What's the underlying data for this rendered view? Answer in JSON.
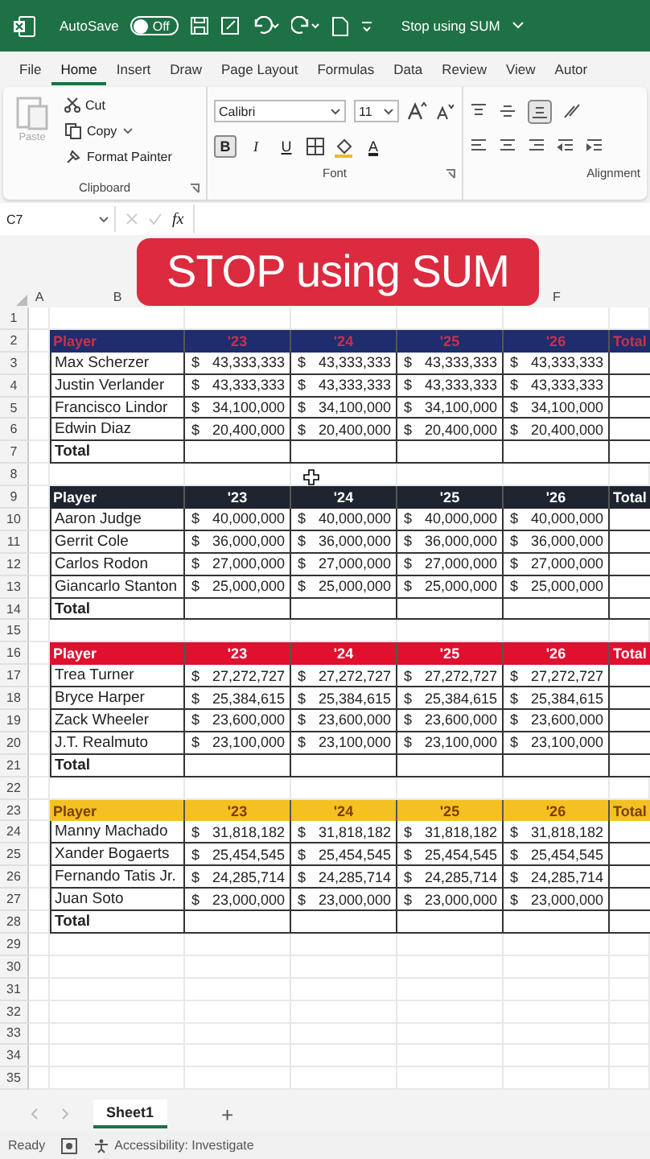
{
  "title_bar": {
    "autosave_label": "AutoSave",
    "autosave_toggle": {
      "label": "Off",
      "on": false
    },
    "file_name": "Stop using SUM"
  },
  "menu_tabs": [
    {
      "label": "File",
      "selected": false
    },
    {
      "label": "Home",
      "selected": true
    },
    {
      "label": "Insert",
      "selected": false
    },
    {
      "label": "Draw",
      "selected": false
    },
    {
      "label": "Page Layout",
      "selected": false
    },
    {
      "label": "Formulas",
      "selected": false
    },
    {
      "label": "Data",
      "selected": false
    },
    {
      "label": "Review",
      "selected": false
    },
    {
      "label": "View",
      "selected": false
    },
    {
      "label": "Autor",
      "selected": false
    }
  ],
  "ribbon": {
    "clipboard": {
      "paste_label": "Paste",
      "cut": "Cut",
      "copy": "Copy",
      "format_painter": "Format Painter",
      "group_label": "Clipboard"
    },
    "font": {
      "font_name": "Calibri",
      "font_size": "11",
      "bold_label": "B",
      "italic_label": "I",
      "underline_label": "U",
      "color_label": "A",
      "bold": true,
      "group_label": "Font"
    },
    "alignment": {
      "group_label": "Alignment"
    }
  },
  "formula_bar": {
    "name_box": "C7",
    "fx_label": "fx"
  },
  "banner": {
    "text": "STOP using SUM"
  },
  "column_headers": [
    {
      "label": "A"
    },
    {
      "label": "B"
    },
    {
      "label": "F"
    }
  ],
  "row_numbers": [
    "1",
    "2",
    "3",
    "4",
    "5",
    "6",
    "7",
    "8",
    "9",
    "10",
    "11",
    "12",
    "13",
    "14",
    "15",
    "16",
    "17",
    "18",
    "19",
    "20",
    "21",
    "22",
    "23",
    "24",
    "25",
    "26",
    "27",
    "28",
    "29",
    "30",
    "31",
    "32",
    "33",
    "34",
    "35"
  ],
  "tables": [
    {
      "color": "#1f2c6e",
      "heading_text": {
        "color": "#c8324c"
      },
      "headers": [
        "Player",
        "'23",
        "'24",
        "'25",
        "'26",
        "Total"
      ],
      "total_label": "Total",
      "rows": [
        {
          "name": "Max Scherzer",
          "values": [
            [
              "$",
              "43,333,333"
            ],
            [
              "$",
              "43,333,333"
            ],
            [
              "$",
              "43,333,333"
            ],
            [
              "$",
              "43,333,333"
            ]
          ]
        },
        {
          "name": "Justin Verlander",
          "values": [
            [
              "$",
              "43,333,333"
            ],
            [
              "$",
              "43,333,333"
            ],
            [
              "$",
              "43,333,333"
            ],
            [
              "$",
              "43,333,333"
            ]
          ]
        },
        {
          "name": "Francisco Lindor",
          "values": [
            [
              "$",
              "34,100,000"
            ],
            [
              "$",
              "34,100,000"
            ],
            [
              "$",
              "34,100,000"
            ],
            [
              "$",
              "34,100,000"
            ]
          ]
        },
        {
          "name": "Edwin Diaz",
          "values": [
            [
              "$",
              "20,400,000"
            ],
            [
              "$",
              "20,400,000"
            ],
            [
              "$",
              "20,400,000"
            ],
            [
              "$",
              "20,400,000"
            ]
          ]
        }
      ]
    },
    {
      "color": "#1e2530",
      "heading_text": {
        "color": "#ffffff"
      },
      "headers": [
        "Player",
        "'23",
        "'24",
        "'25",
        "'26",
        "Total"
      ],
      "total_label": "Total",
      "rows": [
        {
          "name": "Aaron Judge",
          "values": [
            [
              "$",
              "40,000,000"
            ],
            [
              "$",
              "40,000,000"
            ],
            [
              "$",
              "40,000,000"
            ],
            [
              "$",
              "40,000,000"
            ]
          ]
        },
        {
          "name": "Gerrit Cole",
          "values": [
            [
              "$",
              "36,000,000"
            ],
            [
              "$",
              "36,000,000"
            ],
            [
              "$",
              "36,000,000"
            ],
            [
              "$",
              "36,000,000"
            ]
          ]
        },
        {
          "name": "Carlos Rodon",
          "values": [
            [
              "$",
              "27,000,000"
            ],
            [
              "$",
              "27,000,000"
            ],
            [
              "$",
              "27,000,000"
            ],
            [
              "$",
              "27,000,000"
            ]
          ]
        },
        {
          "name": "Giancarlo Stanton",
          "values": [
            [
              "$",
              "25,000,000"
            ],
            [
              "$",
              "25,000,000"
            ],
            [
              "$",
              "25,000,000"
            ],
            [
              "$",
              "25,000,000"
            ]
          ]
        }
      ]
    },
    {
      "color": "#e0102e",
      "heading_text": {
        "color": "#ffffff"
      },
      "headers": [
        "Player",
        "'23",
        "'24",
        "'25",
        "'26",
        "Total"
      ],
      "total_label": "Total",
      "rows": [
        {
          "name": "Trea Turner",
          "values": [
            [
              "$",
              "27,272,727"
            ],
            [
              "$",
              "27,272,727"
            ],
            [
              "$",
              "27,272,727"
            ],
            [
              "$",
              "27,272,727"
            ]
          ]
        },
        {
          "name": "Bryce Harper",
          "values": [
            [
              "$",
              "25,384,615"
            ],
            [
              "$",
              "25,384,615"
            ],
            [
              "$",
              "25,384,615"
            ],
            [
              "$",
              "25,384,615"
            ]
          ]
        },
        {
          "name": "Zack Wheeler",
          "values": [
            [
              "$",
              "23,600,000"
            ],
            [
              "$",
              "23,600,000"
            ],
            [
              "$",
              "23,600,000"
            ],
            [
              "$",
              "23,600,000"
            ]
          ]
        },
        {
          "name": "J.T. Realmuto",
          "values": [
            [
              "$",
              "23,100,000"
            ],
            [
              "$",
              "23,100,000"
            ],
            [
              "$",
              "23,100,000"
            ],
            [
              "$",
              "23,100,000"
            ]
          ]
        }
      ]
    },
    {
      "color": "#f5c021",
      "heading_text": {
        "color": "#7a3e00"
      },
      "headers": [
        "Player",
        "'23",
        "'24",
        "'25",
        "'26",
        "Total"
      ],
      "total_label": "Total",
      "rows": [
        {
          "name": "Manny Machado",
          "values": [
            [
              "$",
              "31,818,182"
            ],
            [
              "$",
              "31,818,182"
            ],
            [
              "$",
              "31,818,182"
            ],
            [
              "$",
              "31,818,182"
            ]
          ]
        },
        {
          "name": "Xander Bogaerts",
          "values": [
            [
              "$",
              "25,454,545"
            ],
            [
              "$",
              "25,454,545"
            ],
            [
              "$",
              "25,454,545"
            ],
            [
              "$",
              "25,454,545"
            ]
          ]
        },
        {
          "name": "Fernando Tatis Jr.",
          "values": [
            [
              "$",
              "24,285,714"
            ],
            [
              "$",
              "24,285,714"
            ],
            [
              "$",
              "24,285,714"
            ],
            [
              "$",
              "24,285,714"
            ]
          ]
        },
        {
          "name": "Juan Soto",
          "values": [
            [
              "$",
              "23,000,000"
            ],
            [
              "$",
              "23,000,000"
            ],
            [
              "$",
              "23,000,000"
            ],
            [
              "$",
              "23,000,000"
            ]
          ]
        }
      ]
    }
  ],
  "sheet_tabs": [
    {
      "label": "Sheet1",
      "selected": true
    }
  ],
  "add_sheet": "+",
  "status_bar": {
    "mode": "Ready",
    "accessibility": "Accessibility: Investigate"
  }
}
